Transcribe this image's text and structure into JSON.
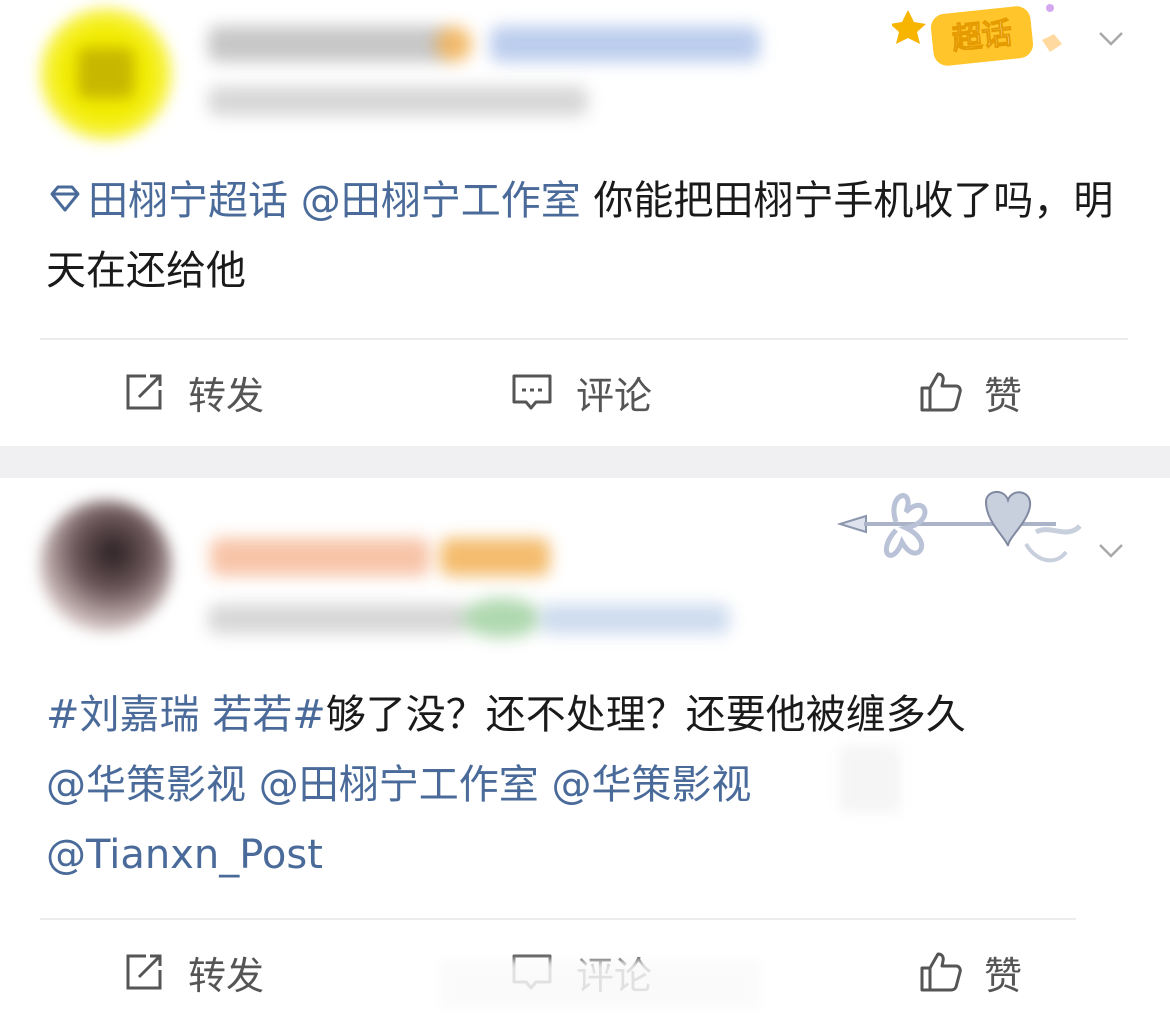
{
  "posts": [
    {
      "content": {
        "topic_label": "田栩宁超话",
        "mention": "@田栩宁工作室",
        "text": "你能把田栩宁手机收了吗，明天在还给他"
      },
      "badge": {
        "label": "超话"
      },
      "actions": {
        "repost": "转发",
        "comment": "评论",
        "like": "赞"
      }
    },
    {
      "content": {
        "hashtag": "#刘嘉瑞 若若#",
        "text": "够了没？还不处理？还要他被缠多久",
        "mentions": [
          "@华策影视",
          "@田栩宁工作室",
          "@华策影视"
        ],
        "mention_last": "@Tianxn_Post"
      },
      "actions": {
        "repost": "转发",
        "comment": "评论",
        "like": "赞"
      }
    }
  ],
  "colors": {
    "link": "#4a6b9a",
    "text": "#1a1a1a",
    "action": "#555555",
    "separator": "#f0f0f2"
  },
  "icons": [
    "repost-icon",
    "comment-icon",
    "like-icon",
    "chevron-down-icon",
    "super-topic-icon"
  ]
}
